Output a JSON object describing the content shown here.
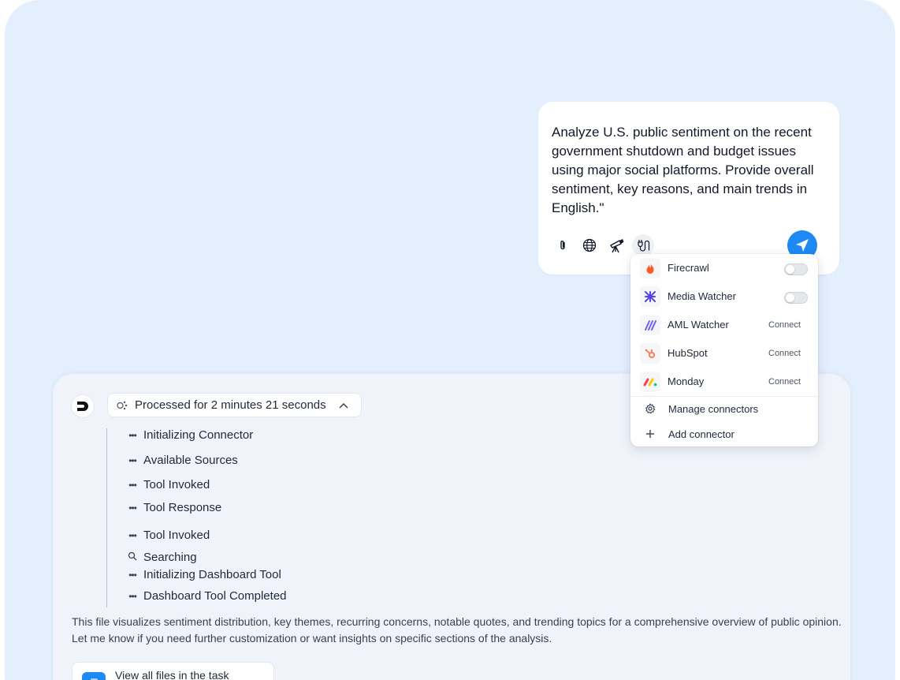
{
  "prompt": {
    "text": "Analyze U.S. public sentiment on the recent government shutdown and budget issues using major social platforms. Provide overall sentiment, key reasons, and main trends in English.\"",
    "tools": [
      "paperclip-icon",
      "globe-icon",
      "telescope-icon",
      "connector-plug-icon"
    ],
    "send_icon": "send-arrow-icon"
  },
  "connectors": {
    "items": [
      {
        "name": "Firecrawl",
        "state": "toggle-off",
        "logo": "flame-icon",
        "color": "#ff5a1f"
      },
      {
        "name": "Media Watcher",
        "state": "toggle-off",
        "logo": "media-watcher-icon",
        "color": "#4f46e5"
      },
      {
        "name": "AML Watcher",
        "state": "Connect",
        "logo": "aml-watcher-icon",
        "color": "#6d5ef6"
      },
      {
        "name": "HubSpot",
        "state": "Connect",
        "logo": "hubspot-icon",
        "color": "#ff7a59"
      },
      {
        "name": "Monday",
        "state": "Connect",
        "logo": "monday-icon",
        "color": "#ff3d57"
      }
    ],
    "actions": [
      {
        "label": "Manage connectors",
        "icon": "gear-icon"
      },
      {
        "label": "Add connector",
        "icon": "plus-icon"
      }
    ]
  },
  "response": {
    "processed_label": "Processed for 2 minutes 21 seconds",
    "steps": [
      {
        "label": "Initializing Connector",
        "icon": "dots"
      },
      {
        "label": "Available Sources",
        "icon": "dots"
      },
      {
        "label": "Tool Invoked",
        "icon": "dots"
      },
      {
        "label": "Tool Response",
        "icon": "dots"
      },
      {
        "label": "Tool Invoked",
        "icon": "dots"
      },
      {
        "label": "Searching",
        "icon": "search-icon"
      },
      {
        "label": "Initializing Dashboard Tool",
        "icon": "dots"
      },
      {
        "label": "Dashboard Tool Completed",
        "icon": "dots"
      }
    ],
    "summary": "This file visualizes sentiment distribution, key themes, recurring concerns, notable quotes, and trending topics for a comprehensive overview of public opinion. Let me know if you need further customization or want insights on specific sections of the analysis.",
    "files_button": "View all files in the task"
  },
  "colors": {
    "background": "#e3effd",
    "accent": "#1d8af4",
    "panel": "#f0f4fa"
  }
}
